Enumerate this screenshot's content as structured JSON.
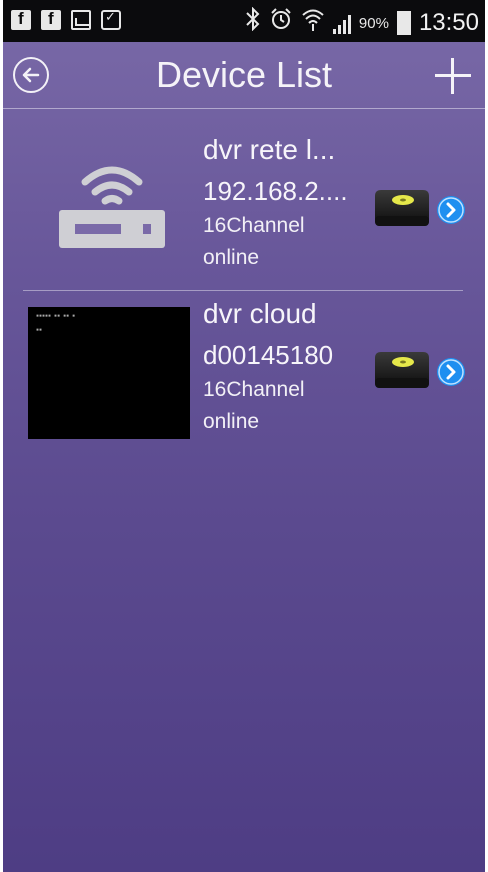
{
  "status_bar": {
    "battery_percent": "90%",
    "time": "13:50",
    "left_icons": [
      "facebook-icon",
      "facebook-icon",
      "gallery-icon",
      "shopping-bag-icon"
    ],
    "right_icons": [
      "bluetooth-icon",
      "alarm-icon",
      "wifi-icon",
      "signal-icon",
      "battery-charging-icon"
    ]
  },
  "header": {
    "title": "Device List",
    "back_icon": "back-circle-icon",
    "add_icon": "plus-icon"
  },
  "devices": [
    {
      "name": "dvr rete l...",
      "address": "192.168.2....",
      "channels": "16Channel",
      "status": "online",
      "thumbnail": "router-icon"
    },
    {
      "name": "dvr cloud",
      "address": "d00145180",
      "channels": "16Channel",
      "status": "online",
      "thumbnail": "video-snapshot"
    }
  ],
  "colors": {
    "background_top": "#7a6aa8",
    "background_bottom": "#4e3d84",
    "accent": "#1e8ff0",
    "hdd_light": "#e5e84a"
  }
}
